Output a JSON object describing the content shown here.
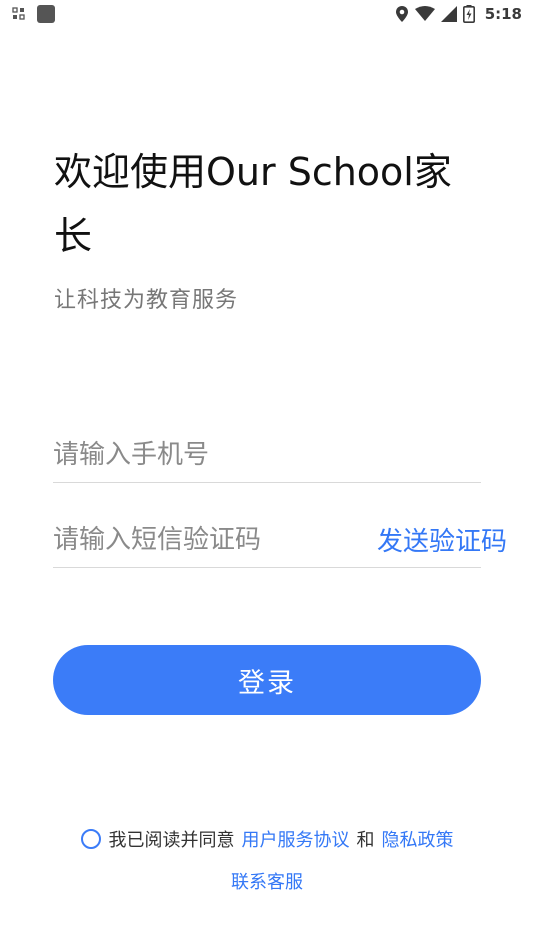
{
  "status_bar": {
    "time": "5:18",
    "icons": [
      "notification-grid-icon",
      "app-square-icon",
      "location-icon",
      "wifi-icon",
      "cell-signal-icon",
      "battery-icon"
    ]
  },
  "header": {
    "title": "欢迎使用Our School家长",
    "subtitle": "让科技为教育服务"
  },
  "form": {
    "phone_placeholder": "请输入手机号",
    "code_placeholder": "请输入短信验证码",
    "send_code_label": "发送验证码",
    "login_label": "登录"
  },
  "agreement": {
    "prefix": "我已阅读并同意",
    "user_agreement": "用户服务协议",
    "conjunction": "和",
    "privacy_policy": "隐私政策",
    "customer_service": "联系客服"
  },
  "colors": {
    "primary": "#3b7cf8",
    "link": "#3478f6",
    "placeholder": "#8a8a8a",
    "subtitle": "#777777"
  }
}
